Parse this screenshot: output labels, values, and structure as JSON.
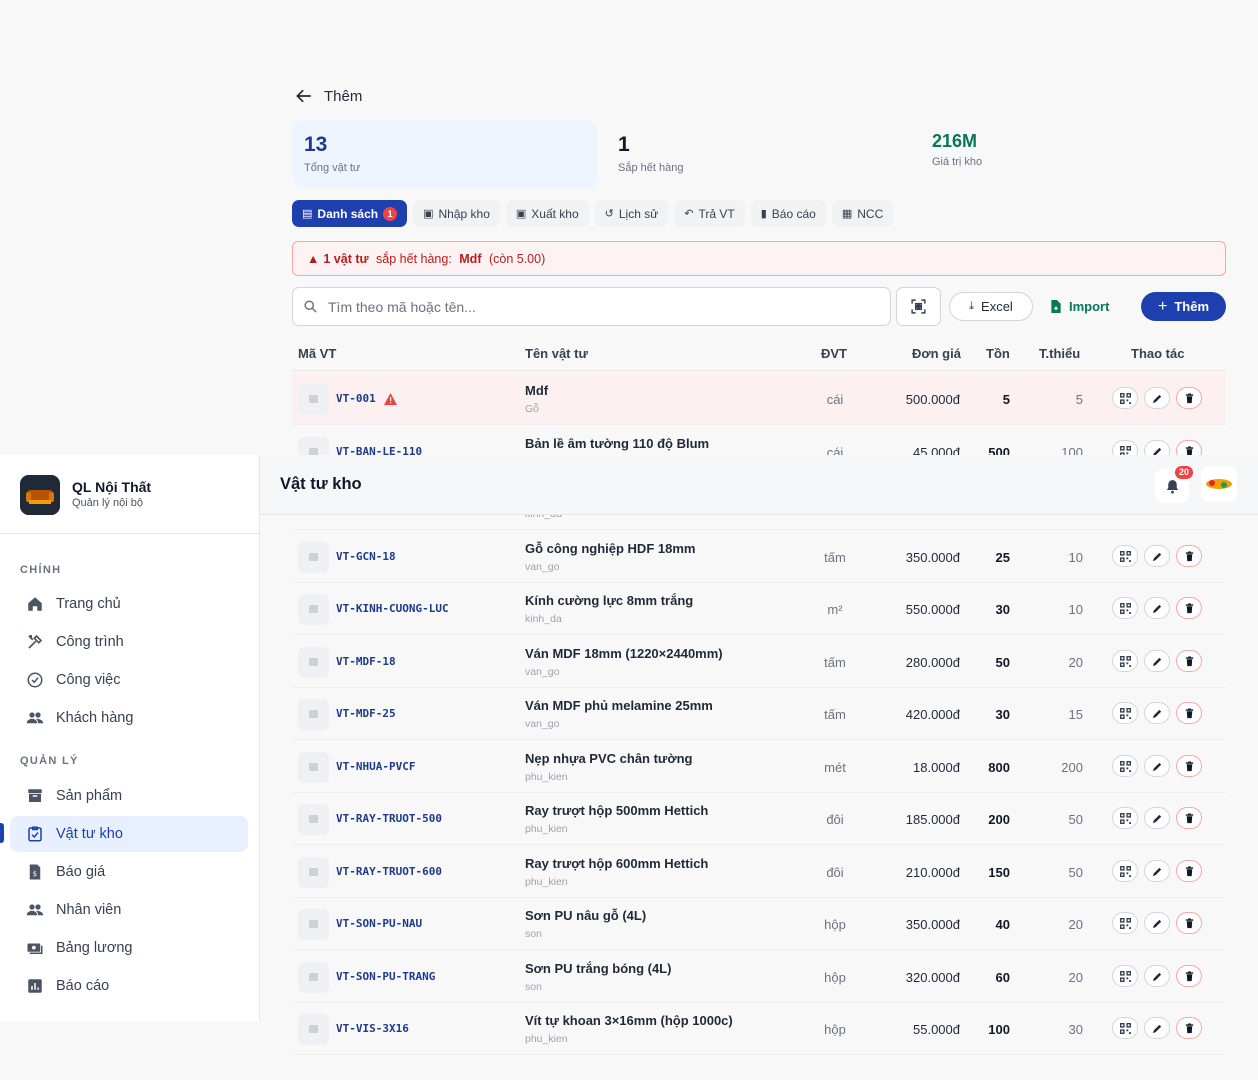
{
  "header": {
    "back_label": "Thêm"
  },
  "stats": [
    {
      "value": "13",
      "label": "Tổng vật tư"
    },
    {
      "value": "1",
      "label": "Sắp hết hàng"
    },
    {
      "value": "216M",
      "label": "Giá trị kho"
    }
  ],
  "tabs": [
    {
      "label": "Danh sách",
      "badge": "1",
      "icon": "list-icon",
      "active": true
    },
    {
      "label": "Nhập kho",
      "icon": "inbox-in-icon"
    },
    {
      "label": "Xuất kho",
      "icon": "inbox-out-icon"
    },
    {
      "label": "Lịch sử",
      "icon": "history-icon"
    },
    {
      "label": "Trả VT",
      "icon": "undo-icon"
    },
    {
      "label": "Báo cáo",
      "icon": "bar-chart-icon"
    },
    {
      "label": "NCC",
      "icon": "store-icon"
    }
  ],
  "alert": {
    "count_text": "1 vật tư",
    "middle": " sắp hết hàng: ",
    "item": "Mdf",
    "suffix": " (còn 5.00)"
  },
  "toolbar": {
    "search_placeholder": "Tìm theo mã hoặc tên...",
    "excel": "Excel",
    "import": "Import",
    "add": "Thêm"
  },
  "table": {
    "headers": {
      "code": "Mã VT",
      "name": "Tên vật tư",
      "unit": "ĐVT",
      "price": "Đơn giá",
      "stock": "Tồn",
      "min": "T.thiểu",
      "actions": "Thao tác"
    },
    "rows": [
      {
        "code": "VT-001",
        "name": "Mdf",
        "cat": "Gỗ",
        "unit": "cái",
        "price": "500.000đ",
        "stock": "5",
        "min": "5",
        "warn": true
      },
      {
        "code": "VT-BAN-LE-110",
        "name": "Bản lề âm tường 110 độ Blum",
        "cat": "",
        "unit": "cái",
        "price": "45.000đ",
        "stock": "500",
        "min": "100"
      },
      {
        "code": "",
        "name": "",
        "cat": "kinh_da",
        "unit": "",
        "price": "",
        "stock": "",
        "min": ""
      },
      {
        "code": "VT-GCN-18",
        "name": "Gỗ công nghiệp HDF 18mm",
        "cat": "van_go",
        "unit": "tấm",
        "price": "350.000đ",
        "stock": "25",
        "min": "10"
      },
      {
        "code": "VT-KINH-CUONG-LUC",
        "name": "Kính cường lực 8mm trắng",
        "cat": "kinh_da",
        "unit": "m²",
        "price": "550.000đ",
        "stock": "30",
        "min": "10"
      },
      {
        "code": "VT-MDF-18",
        "name": "Ván MDF 18mm (1220×2440mm)",
        "cat": "van_go",
        "unit": "tấm",
        "price": "280.000đ",
        "stock": "50",
        "min": "20"
      },
      {
        "code": "VT-MDF-25",
        "name": "Ván MDF phủ melamine 25mm",
        "cat": "van_go",
        "unit": "tấm",
        "price": "420.000đ",
        "stock": "30",
        "min": "15"
      },
      {
        "code": "VT-NHUA-PVCF",
        "name": "Nẹp nhựa PVC chân tường",
        "cat": "phu_kien",
        "unit": "mét",
        "price": "18.000đ",
        "stock": "800",
        "min": "200"
      },
      {
        "code": "VT-RAY-TRUOT-500",
        "name": "Ray trượt hộp 500mm Hettich",
        "cat": "phu_kien",
        "unit": "đôi",
        "price": "185.000đ",
        "stock": "200",
        "min": "50"
      },
      {
        "code": "VT-RAY-TRUOT-600",
        "name": "Ray trượt hộp 600mm Hettich",
        "cat": "phu_kien",
        "unit": "đôi",
        "price": "210.000đ",
        "stock": "150",
        "min": "50"
      },
      {
        "code": "VT-SON-PU-NAU",
        "name": "Sơn PU nâu gỗ (4L)",
        "cat": "son",
        "unit": "hộp",
        "price": "350.000đ",
        "stock": "40",
        "min": "20"
      },
      {
        "code": "VT-SON-PU-TRANG",
        "name": "Sơn PU trắng bóng (4L)",
        "cat": "son",
        "unit": "hộp",
        "price": "320.000đ",
        "stock": "60",
        "min": "20"
      },
      {
        "code": "VT-VIS-3X16",
        "name": "Vít tự khoan 3×16mm (hộp 1000c)",
        "cat": "phu_kien",
        "unit": "hộp",
        "price": "55.000đ",
        "stock": "100",
        "min": "30"
      }
    ]
  },
  "sidebar": {
    "app_name": "QL Nội Thất",
    "app_sub": "Quản lý nội bộ",
    "section1": "CHÍNH",
    "section2": "QUẢN LÝ",
    "items": [
      {
        "label": "Trang chủ",
        "icon": "home-icon"
      },
      {
        "label": "Công trình",
        "icon": "tools-icon"
      },
      {
        "label": "Công việc",
        "icon": "check-circle-icon"
      },
      {
        "label": "Khách hàng",
        "icon": "people-icon"
      },
      {
        "label": "Sản phẩm",
        "icon": "archive-icon"
      },
      {
        "label": "Vật tư kho",
        "icon": "clipboard-check-icon",
        "active": true
      },
      {
        "label": "Báo giá",
        "icon": "invoice-icon"
      },
      {
        "label": "Nhân viên",
        "icon": "people-icon"
      },
      {
        "label": "Bảng lương",
        "icon": "payroll-icon"
      },
      {
        "label": "Báo cáo",
        "icon": "chart-icon"
      }
    ]
  },
  "topbar": {
    "title": "Vật tư kho",
    "notification_count": "20"
  },
  "colors": {
    "primary": "#1e40af",
    "danger": "#ef4444",
    "success": "#047857"
  }
}
